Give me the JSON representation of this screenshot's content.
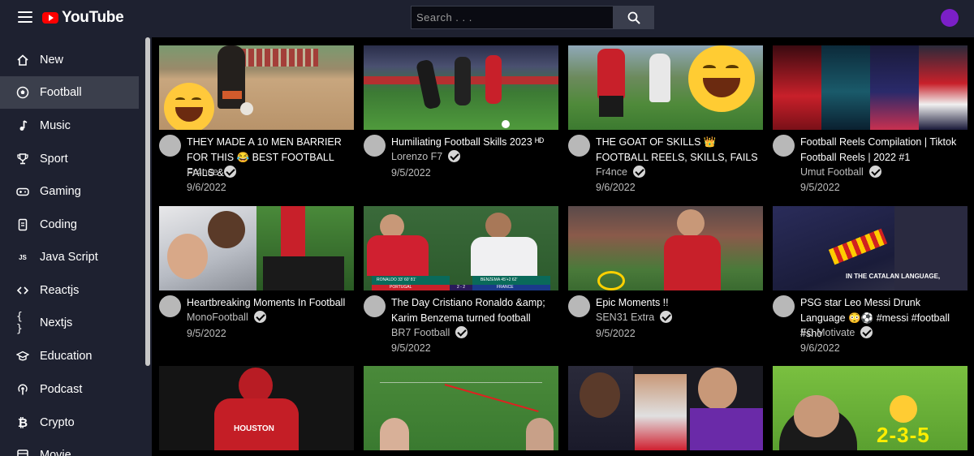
{
  "header": {
    "logo_text": "YouTube",
    "search_placeholder": "Search . . .",
    "colors": {
      "bg": "#1e2130",
      "brand": "#ff0000",
      "avatar": "#7b1fc7"
    }
  },
  "sidebar": {
    "items": [
      {
        "label": "New",
        "icon": "home-icon",
        "glyph": "⌂"
      },
      {
        "label": "Football",
        "icon": "football-icon",
        "glyph": "⚽",
        "active": true
      },
      {
        "label": "Music",
        "icon": "music-note-icon",
        "glyph": "♪"
      },
      {
        "label": "Sport",
        "icon": "trophy-icon",
        "glyph": "🏆"
      },
      {
        "label": "Gaming",
        "icon": "gamepad-icon",
        "glyph": "🎮"
      },
      {
        "label": "Coding",
        "icon": "code-file-icon",
        "glyph": "▯"
      },
      {
        "label": "Java Script",
        "icon": "javascript-icon",
        "glyph": "JS"
      },
      {
        "label": "Reactjs",
        "icon": "angle-brackets-icon",
        "glyph": "<>"
      },
      {
        "label": "Nextjs",
        "icon": "curly-braces-icon",
        "glyph": "{}"
      },
      {
        "label": "Education",
        "icon": "graduation-cap-icon",
        "glyph": "🎓"
      },
      {
        "label": "Podcast",
        "icon": "podcast-icon",
        "glyph": "◉"
      },
      {
        "label": "Crypto",
        "icon": "bitcoin-icon",
        "glyph": "₿"
      },
      {
        "label": "Movie",
        "icon": "film-icon",
        "glyph": "▦"
      }
    ]
  },
  "videos": [
    {
      "title": "THEY MADE A 10 MEN BARRIER FOR THIS 😂 BEST FOOTBALL FAILS &",
      "channel": "Fr4nce",
      "date": "9/6/2022"
    },
    {
      "title": "Humiliating Football Skills 2023 ᴴᴰ",
      "channel": "Lorenzo F7",
      "date": "9/5/2022"
    },
    {
      "title": "THE GOAT OF SKILLS 👑 FOOTBALL REELS, SKILLS, FAILS",
      "channel": "Fr4nce",
      "date": "9/6/2022"
    },
    {
      "title": "Football Reels Compilation | Tiktok Football Reels | 2022 #1",
      "channel": "Umut Football",
      "date": "9/5/2022"
    },
    {
      "title": "Heartbreaking Moments In Football",
      "channel": "MonoFootball",
      "date": "9/5/2022"
    },
    {
      "title": "The Day Cristiano Ronaldo &amp; Karim Benzema turned football",
      "channel": "BR7 Football",
      "date": "9/5/2022"
    },
    {
      "title": "Epic Moments !!",
      "channel": "SEN31 Extra",
      "date": "9/5/2022"
    },
    {
      "title": "PSG star Leo Messi Drunk Language 😳⚽ #messi #football #sho",
      "channel": "FC Motivate",
      "date": "9/6/2022"
    },
    {
      "title": "",
      "channel": "",
      "date": ""
    },
    {
      "title": "",
      "channel": "",
      "date": ""
    },
    {
      "title": "",
      "channel": "",
      "date": ""
    },
    {
      "title": "",
      "channel": "",
      "date": ""
    }
  ],
  "thumbnail_text": {
    "v6_left_banner": "RONALDO 33' 60' 81'",
    "v6_left_country": "PORTUGAL",
    "v6_score": "2 - 2",
    "v6_right_banner": "BENZEMA 45'+2 62'",
    "v6_right_country": "FRANCE",
    "v8_caption": "IN THE CATALAN LANGUAGE,",
    "v9_word": "HOUSTON",
    "v12_formation": "2-3-5"
  }
}
